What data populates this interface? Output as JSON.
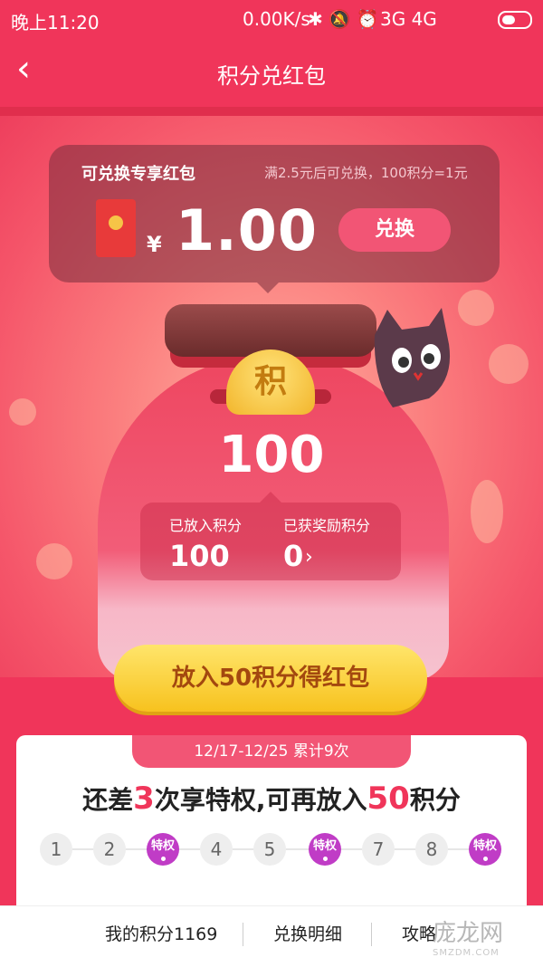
{
  "status_bar": {
    "time": "晚上11:20",
    "network_speed": "0.00K/s",
    "signal_label": "3G 4G"
  },
  "header": {
    "back_icon": "chevron-left-icon",
    "title": "积分兑红包"
  },
  "exchange_card": {
    "title": "可兑换专享红包",
    "note": "满2.5元后可兑换，100积分=1元",
    "currency": "¥",
    "amount": "1.00",
    "button_label": "兑换"
  },
  "jar": {
    "coin_text": "积",
    "points": "100",
    "deposited_label": "已放入积分",
    "deposited_value": "100",
    "rewarded_label": "已获奖励积分",
    "rewarded_value": "0"
  },
  "main_action": {
    "label": "放入50积分得红包"
  },
  "progress": {
    "period": "12/17-12/25 累计9次",
    "text_before": "还差",
    "remaining_times": "3",
    "text_middle": "次享特权,可再放入",
    "remaining_points": "50",
    "text_after": "积分",
    "steps": [
      "1",
      "2",
      "特权",
      "4",
      "5",
      "特权",
      "7",
      "8",
      "特权"
    ]
  },
  "tabbar": {
    "my_points": "我的积分1169",
    "details": "兑换明细",
    "guide": "攻略"
  },
  "watermark": {
    "text": "庞龙网",
    "sub": "SMZDM.COM"
  },
  "colors": {
    "primary": "#f0355a",
    "button_yellow": "#f7c21e",
    "privilege_purple": "#c03cc6"
  }
}
